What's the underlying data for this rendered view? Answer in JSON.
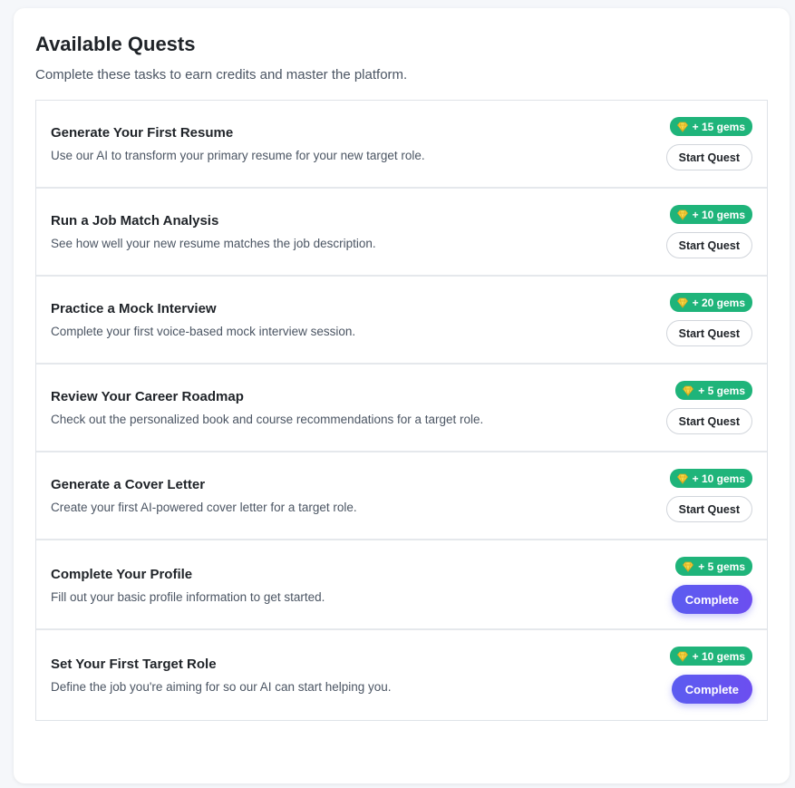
{
  "header": {
    "title": "Available Quests",
    "subtitle": "Complete these tasks to earn credits and master the platform."
  },
  "colors": {
    "badge": "#1fb47a",
    "gem": "#f5d84a",
    "complete_button": "#5b5cf0"
  },
  "quests": [
    {
      "name": "Generate Your First Resume",
      "description": "Use our AI to transform your primary resume for your new target role.",
      "reward": "+ 15 gems",
      "reward_icon": "gem-icon",
      "action": "Start Quest"
    },
    {
      "name": "Run a Job Match Analysis",
      "description": "See how well your new resume matches the job description.",
      "reward": "+ 10 gems",
      "reward_icon": "gem-icon",
      "action": "Start Quest"
    },
    {
      "name": "Practice a Mock Interview",
      "description": "Complete your first voice-based mock interview session.",
      "reward": "+ 20 gems",
      "reward_icon": "gem-icon",
      "action": "Start Quest"
    },
    {
      "name": "Review Your Career Roadmap",
      "description": "Check out the personalized book and course recommendations for a target role.",
      "reward": "+ 5 gems",
      "reward_icon": "gem-icon",
      "action": "Start Quest"
    },
    {
      "name": "Generate a Cover Letter",
      "description": "Create your first AI-powered cover letter for a target role.",
      "reward": "+ 10 gems",
      "reward_icon": "gem-icon",
      "action": "Start Quest"
    },
    {
      "name": "Complete Your Profile",
      "description": "Fill out your basic profile information to get started.",
      "reward": "+ 5 gems",
      "reward_icon": "gem-icon",
      "action": "Complete"
    },
    {
      "name": "Set Your First Target Role",
      "description": "Define the job you're aiming for so our AI can start helping you.",
      "reward": "+ 10 gems",
      "reward_icon": "gem-icon",
      "action": "Complete"
    }
  ]
}
